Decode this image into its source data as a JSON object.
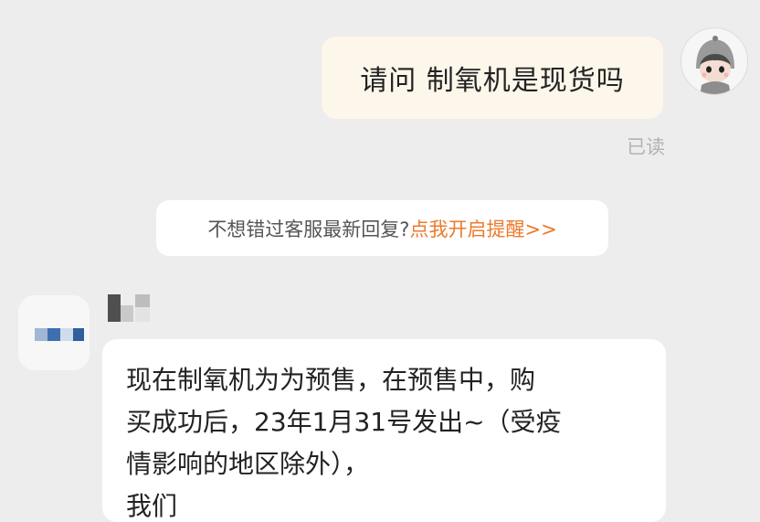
{
  "conversation": {
    "outgoing": {
      "text": "请问 制氧机是现货吗",
      "status": "已读"
    },
    "tip": {
      "text": "不想错过客服最新回复?",
      "link": "点我开启提醒>>"
    },
    "incoming": {
      "lines": [
        "现在制氧机为为预售，在预售中，购",
        "买成功后，23年1月31号发出~（受疫",
        "情影响的地区除外），",
        "我们"
      ]
    }
  },
  "colors": {
    "background": "#ededed",
    "outgoing_bubble": "#fdf6ea",
    "incoming_bubble": "#ffffff",
    "link": "#ec7a2c",
    "read_status": "#b3b3b3"
  },
  "icons": {
    "user_avatar": "cartoon-character-avatar",
    "agent_avatar": "pixelated-avatar",
    "agent_name": "pixelated-name"
  }
}
